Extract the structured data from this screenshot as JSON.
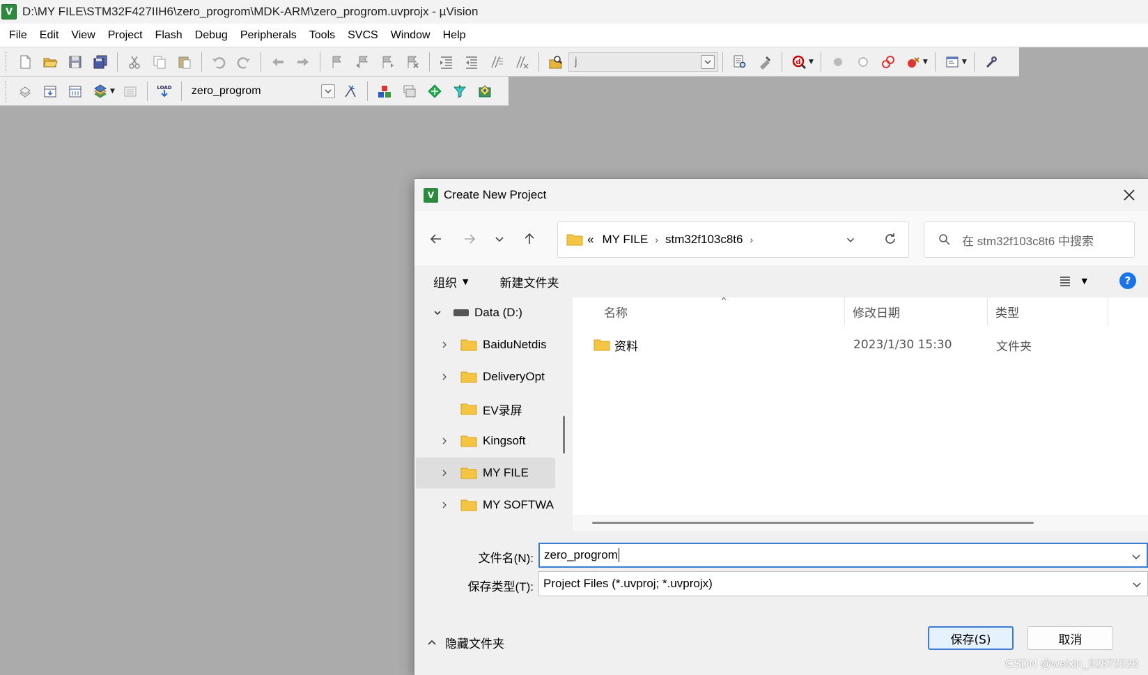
{
  "app": {
    "logo_text": "V",
    "title": "D:\\MY FILE\\STM32F427IIH6\\zero_progrom\\MDK-ARM\\zero_progrom.uvprojx - µVision"
  },
  "menu": [
    "File",
    "Edit",
    "View",
    "Project",
    "Flash",
    "Debug",
    "Peripherals",
    "Tools",
    "SVCS",
    "Window",
    "Help"
  ],
  "toolbar": {
    "find_value": "j",
    "target_value": "zero_progrom"
  },
  "dialog": {
    "title": "Create New Project",
    "nav": {
      "breadcrumb_overflow": "«",
      "crumbs": [
        "MY FILE",
        "stm32f103c8t6"
      ],
      "search_placeholder": "在 stm32f103c8t6 中搜索"
    },
    "commands": {
      "organize": "组织",
      "new_folder": "新建文件夹"
    },
    "help_label": "?",
    "tree": {
      "drive": "Data (D:)",
      "folders": [
        {
          "label": "BaiduNetdis",
          "expandable": true,
          "selected": false
        },
        {
          "label": "DeliveryOpt",
          "expandable": true,
          "selected": false
        },
        {
          "label": "EV录屏",
          "expandable": false,
          "selected": false
        },
        {
          "label": "Kingsoft",
          "expandable": true,
          "selected": false
        },
        {
          "label": "MY FILE",
          "expandable": true,
          "selected": true
        },
        {
          "label": "MY SOFTWA",
          "expandable": true,
          "selected": false
        }
      ]
    },
    "columns": {
      "name": "名称",
      "date": "修改日期",
      "type": "类型"
    },
    "files": [
      {
        "name": "资料",
        "date": "2023/1/30 15:30",
        "type": "文件夹"
      }
    ],
    "fields": {
      "filename_label": "文件名(N):",
      "filename_value": "zero_progrom",
      "filetype_label": "保存类型(T):",
      "filetype_value": "Project Files (*.uvproj; *.uvprojx)"
    },
    "footer": {
      "hide_folders": "隐藏文件夹",
      "save": "保存(S)",
      "cancel": "取消"
    }
  },
  "watermark": "CSDN @weixin_52872520",
  "colors": {
    "accent": "#3a7bd5",
    "folder": "#f4c542",
    "workspace": "#ababab",
    "logo_green": "#2b8a3e"
  }
}
